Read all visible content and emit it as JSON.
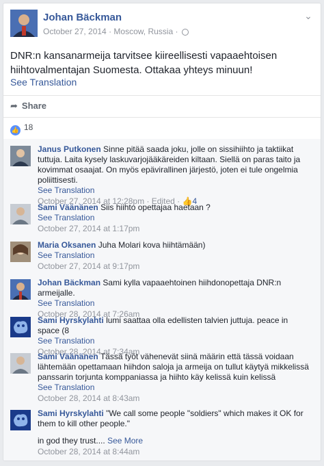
{
  "post": {
    "author": "Johan Bäckman",
    "timestamp": "October 27, 2014",
    "location": "Moscow, Russia",
    "text": "DNR:n kansanarmeija tarvitsee kiireellisesti vapaaehtoisen hiihtovalmentajan Suomesta. Ottakaa yhteys minuun!",
    "see_translation": "See Translation",
    "share_label": "Share",
    "like_count": "18"
  },
  "comments": [
    {
      "name": "Janus Putkonen",
      "text": "Sinne pitää saada joku, jolle on sissihiihto ja taktiikat tuttuja. Laita kysely laskuvarjojääkäreiden kiltaan. Siellä on paras taito ja kovimmat osaajat. On myös epävirallinen järjestö, joten ei tule ongelmia poliittisesti.",
      "see_translation": "See Translation",
      "time": "October 27, 2014 at 12:28pm",
      "edited": "· Edited ·",
      "likes": "4"
    },
    {
      "name": "Sami Väänänen",
      "text": "Siis hiihto opettajaa haetaan ?",
      "see_translation": "See Translation",
      "time": "October 27, 2014 at 1:17pm"
    },
    {
      "name": "Maria Oksanen",
      "text": "Juha Molari kova hiihtämään)",
      "see_translation": "See Translation",
      "time": "October 27, 2014 at 9:17pm"
    },
    {
      "name": "Johan Bäckman",
      "text": "Sami kylla vapaaehtoinen hiihdonopettaja DNR:n armeijalle.",
      "see_translation": "See Translation",
      "time": "October 28, 2014 at 7:26am"
    },
    {
      "name": "Sami Hyrskylahti",
      "text": "lumi saattaa olla edellisten talvien juttuja. peace in space (8",
      "see_translation": "See Translation",
      "time": "October 28, 2014 at 7:34am"
    },
    {
      "name": "Sami Väänänen",
      "text": "Tässä työt vähenevät siinä määrin että tässä voidaan lähtemään opettamaan hiihdon saloja ja armeija on tullut käytyä mikkelissä panssarin torjunta komppaniassa ja hiihto käy kelissä kuin kelissä",
      "see_translation": "See Translation",
      "time": "October 28, 2014 at 8:43am"
    },
    {
      "name": "Sami Hyrskylahti",
      "text": "\"We call some people \"soldiers\" which makes it OK for them to kill other people.\"",
      "text2": "in god they trust....",
      "see_more": "See More",
      "time": "October 28, 2014 at 8:44am"
    }
  ]
}
